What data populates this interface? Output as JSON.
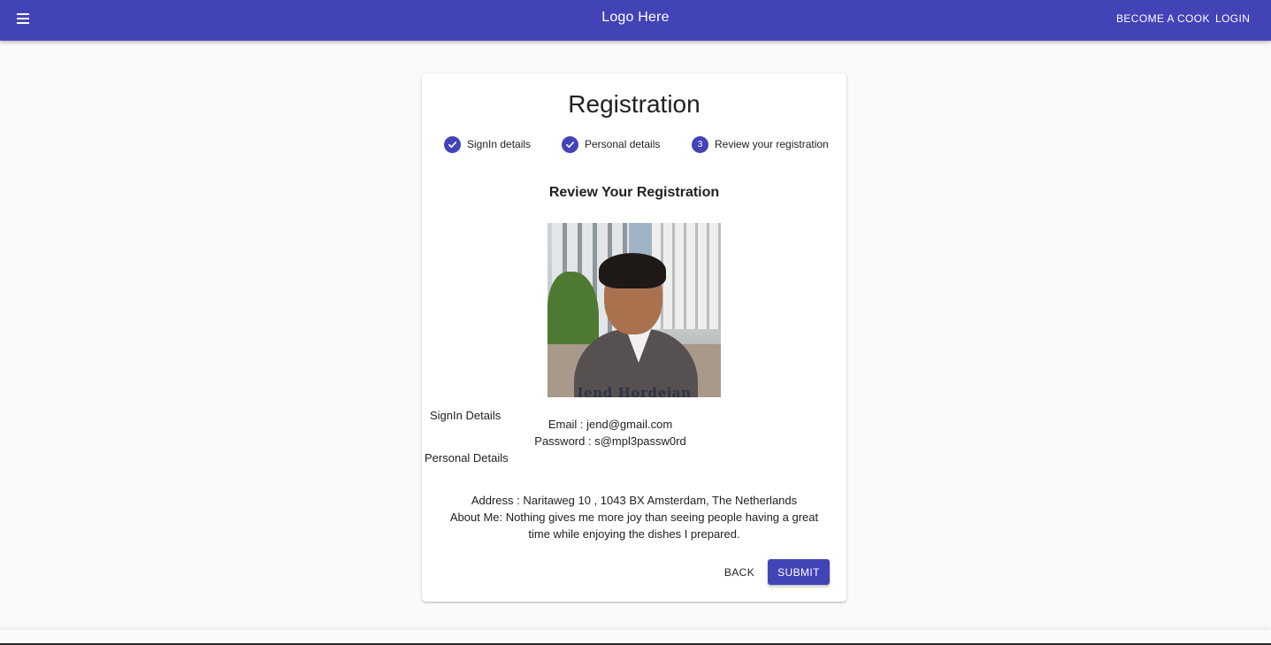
{
  "appbar": {
    "logo": "Logo Here",
    "become_cook": "BECOME A COOK",
    "login": "LOGIN"
  },
  "card": {
    "title": "Registration",
    "steps": [
      {
        "label": "SignIn details",
        "state": "completed"
      },
      {
        "label": "Personal details",
        "state": "completed"
      },
      {
        "label": "Review your registration",
        "state": "active",
        "number": "3"
      }
    ],
    "subtitle": "Review Your Registration",
    "photo_caption": "Jend Hordejan",
    "signin_section": "SignIn Details",
    "email": "Email : jend@gmail.com",
    "password": "Password : s@mpl3passw0rd",
    "personal_section": "Personal Details",
    "address": "Address : Naritaweg 10 , 1043 BX Amsterdam, The Netherlands",
    "about": "About Me: Nothing gives me more joy than seeing people having a great time while enjoying the dishes I prepared.",
    "back_label": "BACK",
    "submit_label": "SUBMIT"
  },
  "colors": {
    "primary": "#4343b8",
    "background": "#fafafa"
  },
  "icons": {
    "menu": "menu-icon",
    "step_done": "check-circle-icon"
  }
}
